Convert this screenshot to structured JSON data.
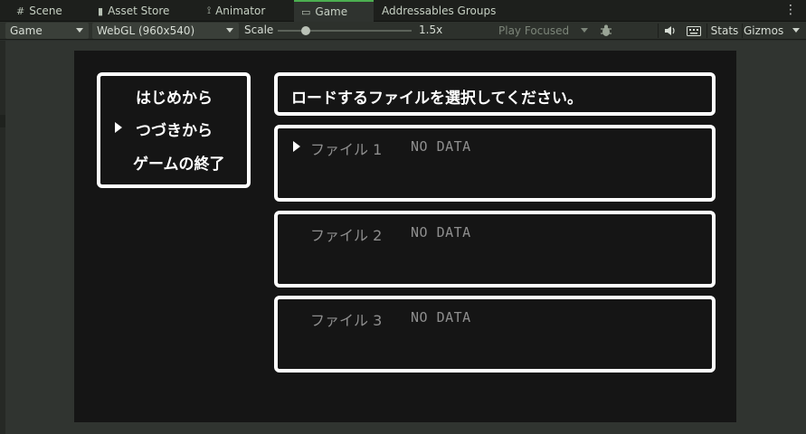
{
  "tabs": [
    {
      "icon": "hash-icon",
      "glyph": "#",
      "label": "Scene"
    },
    {
      "icon": "bag-icon",
      "glyph": "▮",
      "label": "Asset Store"
    },
    {
      "icon": "animator-icon",
      "glyph": "⟟",
      "label": "Animator"
    },
    {
      "icon": "gamepad-icon",
      "glyph": "▭",
      "label": "Game"
    },
    {
      "icon": "",
      "glyph": "",
      "label": "Addressables Groups"
    }
  ],
  "active_tab": "Game",
  "toolbar": {
    "display_dropdown": "Game",
    "resolution_dropdown": "WebGL (960x540)",
    "scale_label": "Scale",
    "scale_value": "1.5x",
    "play_mode_dropdown": "Play Focused",
    "stats_label": "Stats",
    "gizmos_label": "Gizmos"
  },
  "game": {
    "menu": [
      {
        "label": "はじめから",
        "selected": false
      },
      {
        "label": "つづきから",
        "selected": true
      },
      {
        "label": "ゲームの終了",
        "selected": false
      }
    ],
    "header": "ロードするファイルを選択してください。",
    "slots": [
      {
        "label": "ファイル 1",
        "status": "NO DATA",
        "selected": true
      },
      {
        "label": "ファイル 2",
        "status": "NO DATA",
        "selected": false
      },
      {
        "label": "ファイル 3",
        "status": "NO DATA",
        "selected": false
      }
    ]
  },
  "colors": {
    "accent": "#4caf50",
    "game_bg": "#151515",
    "box_border": "#ffffff",
    "dim_text": "#8e8e8e"
  }
}
